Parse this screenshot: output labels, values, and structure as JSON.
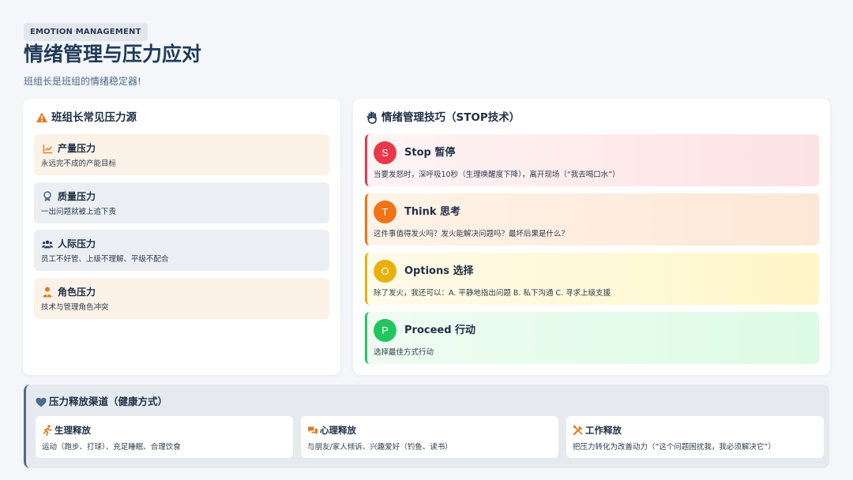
{
  "header": {
    "tag": "EMOTION MANAGEMENT",
    "title": "情绪管理与压力应对",
    "subtitle": "班组长是班组的情绪稳定器!"
  },
  "pressure": {
    "title": "班组长常见压力源",
    "icon": "warning-icon",
    "items": [
      {
        "label": "产量压力",
        "desc": "永远完不成的产能目标",
        "icon": "chart-line-icon"
      },
      {
        "label": "质量压力",
        "desc": "一出问题就被上追下责",
        "icon": "award-icon"
      },
      {
        "label": "人际压力",
        "desc": "员工不好管、上级不理解、平级不配合",
        "icon": "users-icon"
      },
      {
        "label": "角色压力",
        "desc": "技术与管理角色冲突",
        "icon": "user-tie-icon"
      }
    ]
  },
  "stop": {
    "title": "情绪管理技巧（STOP技术）",
    "icon": "hand-icon",
    "steps": [
      {
        "letter": "S",
        "label": "Stop 暂停",
        "desc": "当要发怒时，深呼吸10秒（生理唤醒度下降），离开现场（“我去喝口水”）",
        "color": "#e8384a"
      },
      {
        "letter": "T",
        "label": "Think 思考",
        "desc": "这件事值得发火吗？发火能解决问题吗？最坏后果是什么？",
        "color": "#f07416"
      },
      {
        "letter": "O",
        "label": "Options 选择",
        "desc": "除了发火，我还可以：A. 平静地指出问题 B. 私下沟通 C. 寻求上级支援",
        "color": "#e9b00c"
      },
      {
        "letter": "P",
        "label": "Proceed 行动",
        "desc": "选择最佳方式行动",
        "color": "#22c55e"
      }
    ]
  },
  "release": {
    "title": "压力释放渠道（健康方式）",
    "icon": "heart-icon",
    "items": [
      {
        "label": "生理释放",
        "desc": "运动（跑步、打球）、充足睡眠、合理饮食",
        "icon": "running-icon"
      },
      {
        "label": "心理释放",
        "desc": "与朋友/家人倾诉、兴趣爱好（钓鱼、读书）",
        "icon": "chat-icon"
      },
      {
        "label": "工作释放",
        "desc": "把压力转化为改善动力（“这个问题困扰我，我必须解决它”）",
        "icon": "tools-icon"
      }
    ]
  },
  "colors": {
    "accent_orange": "#e07b1f",
    "navy": "#1f3b5a",
    "bottom_border": "#4e6a8c"
  }
}
